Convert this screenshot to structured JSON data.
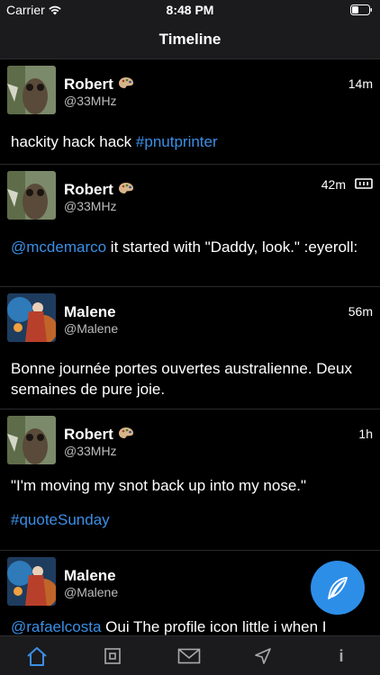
{
  "status": {
    "carrier": "Carrier",
    "time": "8:48 PM"
  },
  "nav": {
    "title": "Timeline"
  },
  "posts": [
    {
      "name": "Robert",
      "handle": "@33MHz",
      "time": "14m",
      "text_parts": [
        "hackity hack hack "
      ],
      "links": [
        "#pnutprinter"
      ]
    },
    {
      "name": "Robert",
      "handle": "@33MHz",
      "time": "42m",
      "mention": "@mcdemarco",
      "text": " it started with \"Daddy, look.\" :eyeroll:"
    },
    {
      "name": "Malene",
      "handle": "@Malene",
      "time": "56m",
      "text": "Bonne journée portes ouvertes australienne. Deux semaines de pure joie."
    },
    {
      "name": "Robert",
      "handle": "@33MHz",
      "time": "1h",
      "text": "\"I'm moving my snot back up into my nose.\"",
      "hashtag": "#quoteSunday"
    },
    {
      "name": "Malene",
      "handle": "@Malene",
      "mention": "@rafaelcosta",
      "text": " Oui The profile icon little i when I"
    }
  ],
  "colors": {
    "accent": "#3b8fe6",
    "fab": "#2d8ee8",
    "bar": "#1b1b1d"
  },
  "tabs": [
    "home-icon",
    "channels-icon",
    "messages-icon",
    "explore-icon",
    "info-icon"
  ],
  "tab_info_label": "i"
}
